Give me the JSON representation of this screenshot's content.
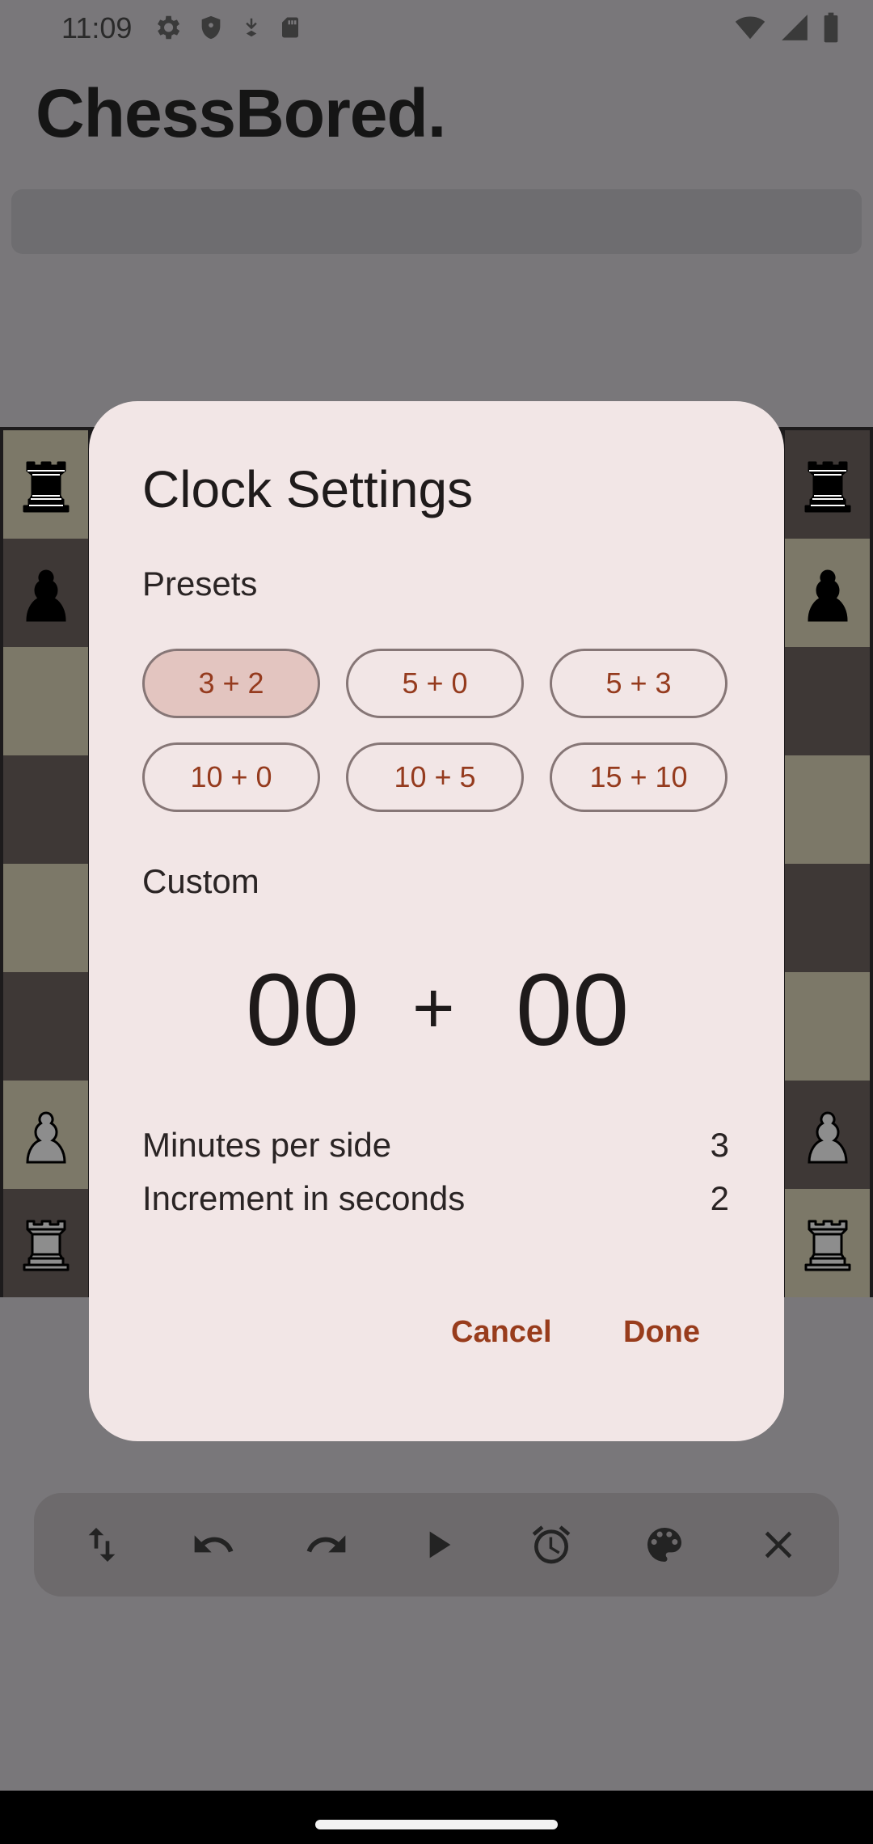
{
  "status_bar": {
    "time": "11:09"
  },
  "app": {
    "title": "ChessBored."
  },
  "dialog": {
    "title": "Clock Settings",
    "presets_label": "Presets",
    "presets": [
      {
        "label": "3 + 2",
        "selected": true
      },
      {
        "label": "5 + 0",
        "selected": false
      },
      {
        "label": "5 + 3",
        "selected": false
      },
      {
        "label": "10 + 0",
        "selected": false
      },
      {
        "label": "10 + 5",
        "selected": false
      },
      {
        "label": "15 + 10",
        "selected": false
      }
    ],
    "custom_label": "Custom",
    "custom_minutes": "00",
    "custom_plus": "+",
    "custom_seconds": "00",
    "minutes_label": "Minutes per side",
    "minutes_value": "3",
    "increment_label": "Increment in seconds",
    "increment_value": "2",
    "cancel_label": "Cancel",
    "done_label": "Done"
  },
  "toolbar_icons": [
    "swap-vert-icon",
    "undo-icon",
    "redo-icon",
    "play-icon",
    "alarm-icon",
    "palette-icon",
    "close-icon"
  ],
  "colors": {
    "accent": "#983c1c",
    "dialog_bg": "#f2e6e6",
    "scrim": "#79777a"
  }
}
